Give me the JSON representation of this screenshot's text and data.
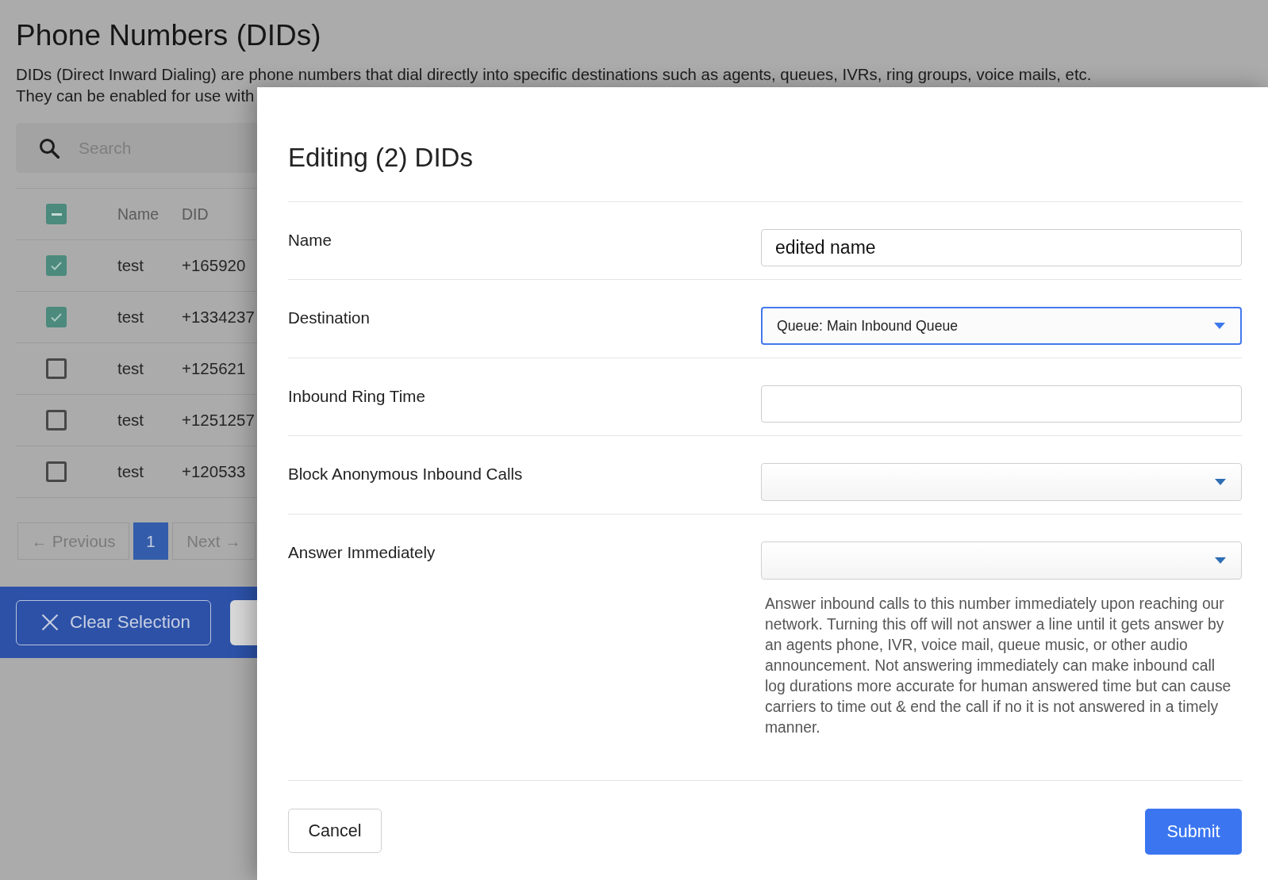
{
  "page": {
    "title": "Phone Numbers (DIDs)",
    "description_lines": [
      "DIDs (Direct Inward Dialing) are phone numbers that dial directly into specific destinations such as agents, queues, IVRs, ring groups, voice mails, etc.",
      "They can be enabled for use with"
    ],
    "search": {
      "placeholder": "Search"
    },
    "table": {
      "select_all": {
        "indeterminate": true
      },
      "columns": [
        "Name",
        "DID"
      ],
      "rows": [
        {
          "selected": true,
          "name": "test",
          "did": "+165920"
        },
        {
          "selected": true,
          "name": "test",
          "did": "+1334237"
        },
        {
          "selected": false,
          "name": "test",
          "did": "+125621"
        },
        {
          "selected": false,
          "name": "test",
          "did": "+1251257"
        },
        {
          "selected": false,
          "name": "test",
          "did": "+120533"
        }
      ]
    },
    "pagination": {
      "previous": "← Previous",
      "pages": [
        {
          "label": "1",
          "selected": true
        }
      ],
      "next": "Next →"
    },
    "selection_bar": {
      "buttons": [
        {
          "kind": "outline",
          "label": "Clear Selection"
        },
        {
          "kind": "solid"
        }
      ]
    }
  },
  "modal": {
    "title": "Editing (2) DIDs",
    "fields": [
      {
        "label": "Name",
        "kind": "text",
        "value": "edited name",
        "focused": false
      },
      {
        "label": "Destination",
        "kind": "select",
        "value": "Queue: Main Inbound Queue",
        "focused": true
      },
      {
        "label": "Inbound Ring Time",
        "kind": "text",
        "focused": false
      },
      {
        "label": "Block Anonymous Inbound Calls",
        "kind": "select",
        "focused": false
      },
      {
        "label": "Answer Immediately",
        "kind": "select",
        "focused": false,
        "help": "Answer inbound calls to this number immediately upon reaching our network. Turning this off will not answer a line until it gets answer by an agents phone, IVR, voice mail, queue music, or other audio announcement. Not answering immediately can make inbound call log durations more accurate for human answered time but can cause carriers to time out & end the call if no it is not answered in a timely manner."
      }
    ],
    "buttons": {
      "cancel": "Cancel",
      "submit": "Submit"
    }
  }
}
